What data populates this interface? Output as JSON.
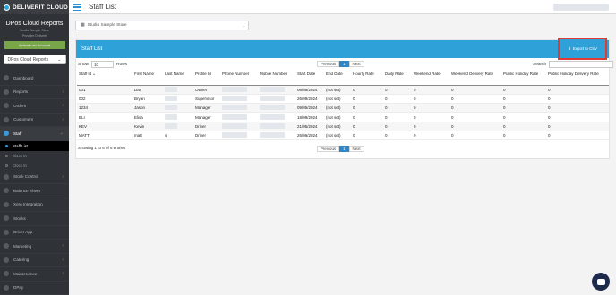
{
  "app": {
    "brand": "DELIVERIT CLOUD",
    "page_title": "Staff List"
  },
  "sidebar": {
    "title": "DPos Cloud Reports",
    "subtitle_1": "Studio Sample Store",
    "subtitle_2": "Provider Deliverit",
    "activate_label": "Activate an Account",
    "report_select": "DPos Cloud Reports",
    "items": [
      {
        "label": "Dashboard",
        "chevron": false
      },
      {
        "label": "Reports",
        "chevron": true
      },
      {
        "label": "Orders",
        "chevron": true
      },
      {
        "label": "Customers",
        "chevron": true
      },
      {
        "label": "Staff",
        "chevron": true,
        "active": true
      },
      {
        "label": "Stock Control",
        "chevron": true
      },
      {
        "label": "Balance Sheet",
        "chevron": false
      },
      {
        "label": "Xero Integration",
        "chevron": false
      },
      {
        "label": "Stocks",
        "chevron": false
      },
      {
        "label": "Driver App",
        "chevron": false
      },
      {
        "label": "Marketing",
        "chevron": true
      },
      {
        "label": "Catering",
        "chevron": true
      },
      {
        "label": "Maintenance",
        "chevron": true
      },
      {
        "label": "DPay",
        "chevron": false
      }
    ],
    "staff_sub_items": [
      {
        "label": "Staff List",
        "current": true
      },
      {
        "label": "Clock In",
        "current": false
      },
      {
        "label": "Clock In",
        "current": false
      }
    ]
  },
  "store_selector": {
    "value": "Studio Sample Store"
  },
  "panel": {
    "title": "Staff List",
    "export_label": "Export to CSV",
    "show_label": "Show",
    "show_value": "10",
    "rows_label": "Rows",
    "search_label": "Search",
    "pager": {
      "previous": "Previous",
      "current": "1",
      "next": "Next"
    },
    "showing_text": "Showing 1 to 6 of 6 entries"
  },
  "table": {
    "columns": [
      "Staff Id",
      "First Name",
      "Last Name",
      "Profile Id",
      "Phone Number",
      "Mobile Number",
      "Start Date",
      "End Date",
      "Hourly Rate",
      "Daily Rate",
      "Weekend Rate",
      "Weekend Delivery Rate",
      "Public Holiday Rate",
      "Public Holiday Delivery Rate"
    ],
    "rows": [
      {
        "staff_id": "001",
        "first": "Dan",
        "last": "",
        "profile": "Owner",
        "start": "06/05/2024",
        "end": "(not set)",
        "hourly": "0",
        "daily": "0",
        "weekend": "0",
        "weekend_del": "0",
        "ph": "0",
        "ph_del": "0"
      },
      {
        "staff_id": "002",
        "first": "Bryan",
        "last": "",
        "profile": "Supervisor",
        "start": "26/09/2024",
        "end": "(not set)",
        "hourly": "0",
        "daily": "0",
        "weekend": "0",
        "weekend_del": "0",
        "ph": "0",
        "ph_del": "0"
      },
      {
        "staff_id": "1234",
        "first": "Jason",
        "last": "",
        "profile": "Manager",
        "start": "09/05/2024",
        "end": "(not set)",
        "hourly": "0",
        "daily": "0",
        "weekend": "0",
        "weekend_del": "0",
        "ph": "0",
        "ph_del": "0"
      },
      {
        "staff_id": "ELI",
        "first": "Elisa",
        "last": "",
        "profile": "Manager",
        "start": "18/09/2024",
        "end": "(not set)",
        "hourly": "0",
        "daily": "0",
        "weekend": "0",
        "weekend_del": "0",
        "ph": "0",
        "ph_del": "0"
      },
      {
        "staff_id": "KEV",
        "first": "Kevin",
        "last": "",
        "profile": "Driver",
        "start": "21/05/2024",
        "end": "(not set)",
        "hourly": "0",
        "daily": "0",
        "weekend": "0",
        "weekend_del": "0",
        "ph": "0",
        "ph_del": "0"
      },
      {
        "staff_id": "MATT",
        "first": "matt",
        "last": "s",
        "profile": "Driver",
        "start": "26/06/2024",
        "end": "(not set)",
        "hourly": "0",
        "daily": "0",
        "weekend": "0",
        "weekend_del": "0",
        "ph": "0",
        "ph_del": "0"
      }
    ]
  },
  "colors": {
    "accent": "#2ea1d9",
    "sidebar_bg": "#2f3337",
    "highlight_border": "#e03a32",
    "activate_green": "#7aa64a"
  }
}
